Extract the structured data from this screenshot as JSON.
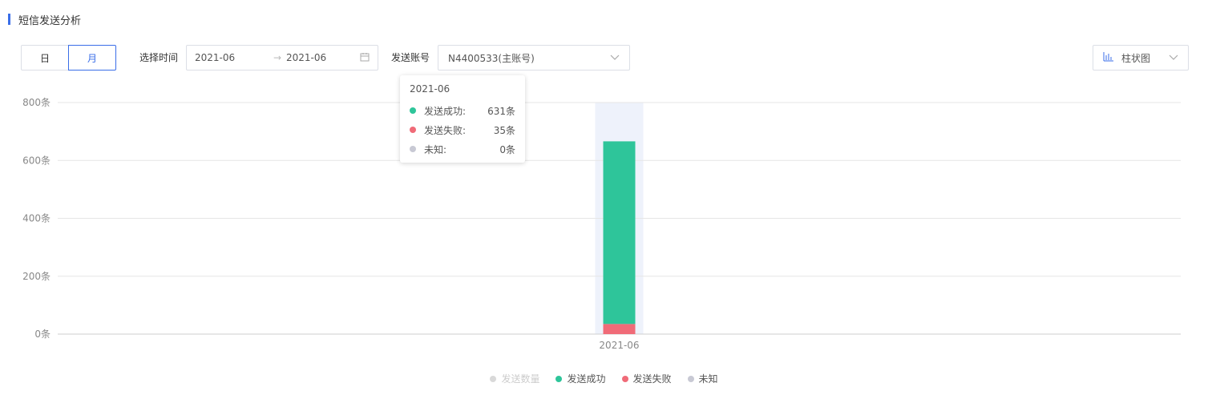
{
  "section_title": "短信发送分析",
  "period_toggle": {
    "day_label": "日",
    "month_label": "月",
    "selected": "月"
  },
  "time_filter": {
    "label": "选择时间",
    "start": "2021-06",
    "arrow": "→",
    "end": "2021-06",
    "calendar_icon": "calendar-icon"
  },
  "account_filter": {
    "label": "发送账号",
    "value": "N4400533(主账号)",
    "chevron": "⌵"
  },
  "chart_type_select": {
    "label": "柱状图",
    "icon": "bar-chart-icon",
    "chevron": "⌵"
  },
  "tooltip": {
    "title": "2021-06",
    "rows": [
      {
        "name": "发送成功:",
        "value": "631条",
        "color": "#2ec59a"
      },
      {
        "name": "发送失败:",
        "value": "35条",
        "color": "#f06b78"
      },
      {
        "name": "未知:",
        "value": "0条",
        "color": "#c8c9d4"
      }
    ]
  },
  "legend": [
    {
      "name": "发送数量",
      "color": "#cccccc",
      "disabled": true
    },
    {
      "name": "发送成功",
      "color": "#2ec59a",
      "disabled": false
    },
    {
      "name": "发送失败",
      "color": "#f06b78",
      "disabled": false
    },
    {
      "name": "未知",
      "color": "#c8c9d4",
      "disabled": false
    }
  ],
  "chart_data": {
    "type": "bar",
    "stacked": true,
    "categories": [
      "2021-06"
    ],
    "series": [
      {
        "name": "发送失败",
        "values": [
          35
        ],
        "color": "#f06b78"
      },
      {
        "name": "发送成功",
        "values": [
          631
        ],
        "color": "#2ec59a"
      },
      {
        "name": "未知",
        "values": [
          0
        ],
        "color": "#c8c9d4"
      }
    ],
    "y_ticks": [
      "0条",
      "200条",
      "400条",
      "600条",
      "800条"
    ],
    "ylim": [
      0,
      800
    ],
    "grid": true,
    "hover_highlight_color": "#eef2fb"
  }
}
